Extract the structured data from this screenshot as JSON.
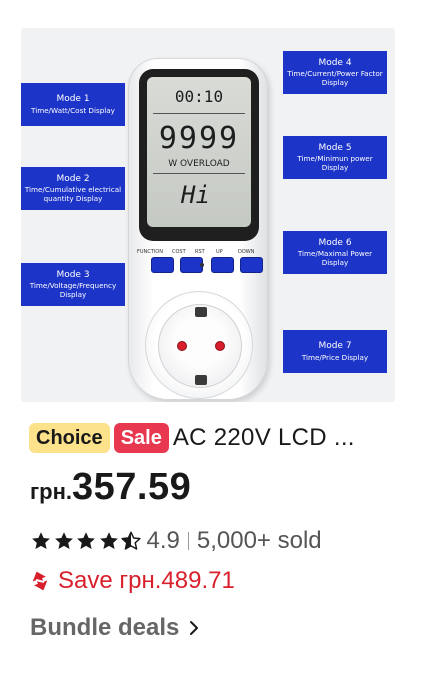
{
  "product_image": {
    "modes": [
      {
        "title": "Mode 1",
        "desc": "Time/Watt/Cost Display"
      },
      {
        "title": "Mode 2",
        "desc": "Time/Cumulative electrical quantity Display"
      },
      {
        "title": "Mode 3",
        "desc": "Time/Voltage/Frequency Display"
      },
      {
        "title": "Mode 4",
        "desc": "Time/Current/Power Factor Display"
      },
      {
        "title": "Mode 5",
        "desc": "Time/Minimun power Display"
      },
      {
        "title": "Mode 6",
        "desc": "Time/Maximal Power Display"
      },
      {
        "title": "Mode 7",
        "desc": "Time/Price Display"
      }
    ],
    "lcd": {
      "time": "00:10",
      "digits": "9999",
      "status": "W  OVERLOAD",
      "bottom": "Hi"
    },
    "buttons": [
      "FUNCTION",
      "COST",
      "RST",
      "UP",
      "DOWN"
    ]
  },
  "badges": {
    "choice": "Choice",
    "sale": "Sale"
  },
  "title": "AC 220V LCD ...",
  "price": {
    "currency": "грн.",
    "amount": "357.59"
  },
  "rating": {
    "value": "4.9",
    "stars": 4.5,
    "sold": "5,000+ sold"
  },
  "save": {
    "label": "Save грн.489.71"
  },
  "bundle": {
    "label": "Bundle deals"
  },
  "colors": {
    "sale": "#e8384f",
    "choice": "#fde28c",
    "save": "#d91f2b",
    "mode_box": "#1c34c7"
  }
}
